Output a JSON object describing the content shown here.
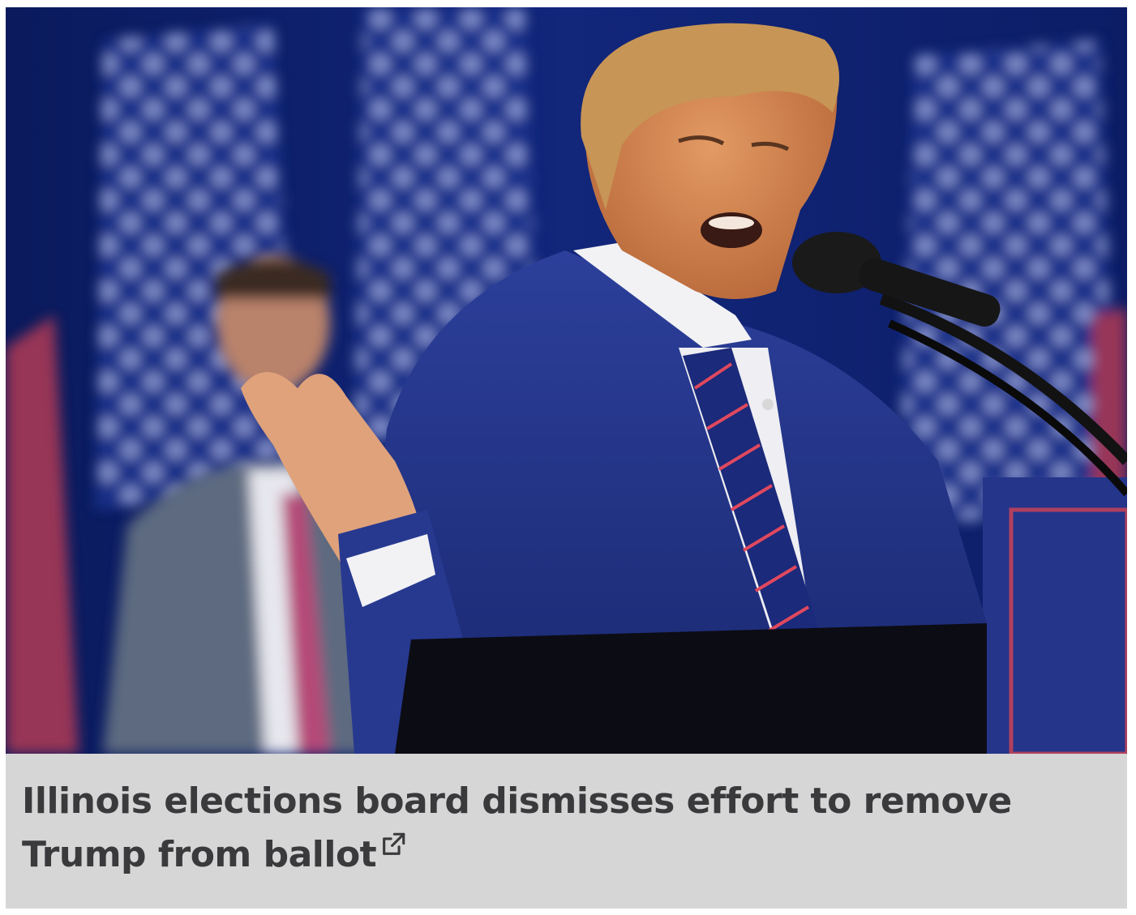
{
  "article": {
    "image_alt": "Donald Trump speaking at a podium with American flags behind him",
    "headline": "Illinois elections board dismisses effort to remove Trump from ballot",
    "link_icon": "external-link-icon"
  },
  "colors": {
    "caption_background": "#d6d6d6",
    "headline_text": "#3a3a3d",
    "photo_backdrop": "#0f1f63"
  }
}
